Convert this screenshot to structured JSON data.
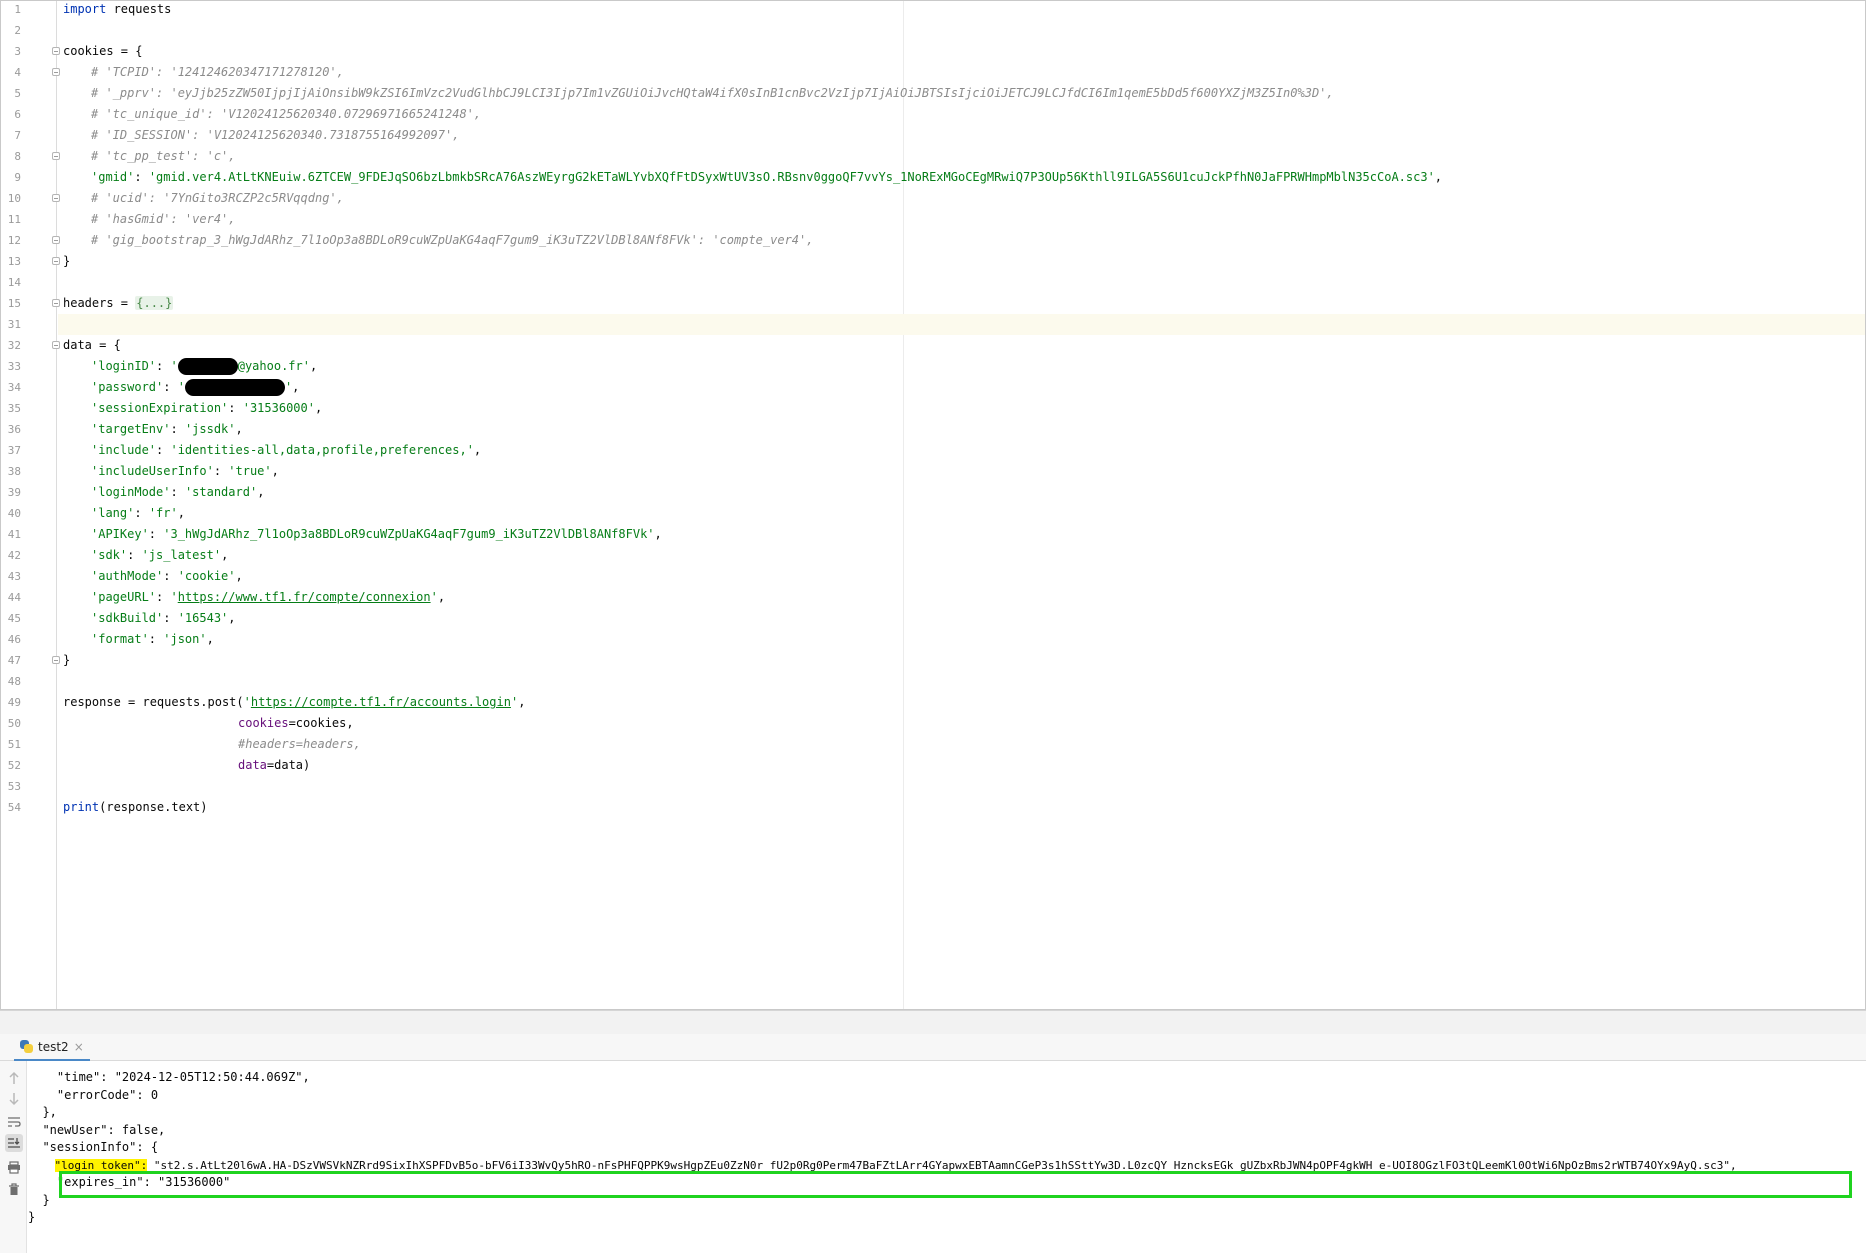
{
  "editor": {
    "lines": [
      {
        "num": "1",
        "segments": [
          {
            "t": "import",
            "c": "kw"
          },
          {
            "t": " requests",
            "c": "plain"
          }
        ]
      },
      {
        "num": "2",
        "segments": []
      },
      {
        "num": "3",
        "segments": [
          {
            "t": "cookies = {",
            "c": "plain"
          }
        ]
      },
      {
        "num": "4",
        "segments": [
          {
            "t": "# 'TCPID': '124124620347171278120',",
            "c": "com"
          }
        ]
      },
      {
        "num": "5",
        "segments": [
          {
            "t": "# '_pprv': 'eyJjb25zZW50IjpjIjAiOnsibW9kZSI6ImVzc2VudGlhbCJ9LCI3Ijp7Im1vZGUiOiJvcHQtaW4ifX0sInB1cnBvc2VzIjp7IjAiOiJBTSIsIjciOiJETCJ9LCJfdCI6Im1qemE5bDd5f600YXZjM3Z5In0%3D',",
            "c": "com"
          }
        ]
      },
      {
        "num": "6",
        "segments": [
          {
            "t": "# 'tc_unique_id': 'V12024125620340.07296971665241248',",
            "c": "com"
          }
        ]
      },
      {
        "num": "7",
        "segments": [
          {
            "t": "# 'ID_SESSION': 'V12024125620340.7318755164992097',",
            "c": "com"
          }
        ]
      },
      {
        "num": "8",
        "segments": [
          {
            "t": "# 'tc_pp_test': 'c',",
            "c": "com"
          }
        ]
      },
      {
        "num": "9",
        "segments": [
          {
            "t": "'gmid'",
            "c": "str"
          },
          {
            "t": ": ",
            "c": "plain"
          },
          {
            "t": "'gmid.ver4.AtLtKNEuiw.6ZTCEW_9FDEJqSO6bzLbmkbSRcA76AszWEyrgG2kETaWLYvbXQfFtDSyxWtUV3sO.RBsnv0ggoQF7vvYs_1NoRExMGoCEgMRwiQ7P3OUp56Kthll9ILGA5S6U1cuJckPfhN0JaFPRWHmpMblN35cCoA.sc3'",
            "c": "str"
          },
          {
            "t": ",",
            "c": "plain"
          }
        ]
      },
      {
        "num": "10",
        "segments": [
          {
            "t": "# 'ucid': '7YnGito3RCZP2c5RVqqdng',",
            "c": "com"
          }
        ]
      },
      {
        "num": "11",
        "segments": [
          {
            "t": "# 'hasGmid': 'ver4',",
            "c": "com"
          }
        ]
      },
      {
        "num": "12",
        "segments": [
          {
            "t": "# 'gig_bootstrap_3_hWgJdARhz_7l1oOp3a8BDLoR9cuWZpUaKG4aqF7gum9_iK3uTZ2VlDBl8ANf8FVk': 'compte_ver4',",
            "c": "com"
          }
        ]
      },
      {
        "num": "13",
        "segments": [
          {
            "t": "}",
            "c": "plain"
          }
        ]
      },
      {
        "num": "14",
        "segments": []
      },
      {
        "num": "15",
        "segments": [
          {
            "t": "headers = ",
            "c": "plain"
          },
          {
            "t": "{...}",
            "c": "folded"
          }
        ]
      },
      {
        "num": "31",
        "segments": []
      },
      {
        "num": "32",
        "segments": [
          {
            "t": "data = {",
            "c": "plain"
          }
        ]
      },
      {
        "num": "33",
        "segments": [
          {
            "t": "'loginID'",
            "c": "str"
          },
          {
            "t": ": ",
            "c": "plain"
          },
          {
            "t": "'",
            "c": "str"
          },
          {
            "t": "",
            "c": "redact-a"
          },
          {
            "t": "@yahoo.fr'",
            "c": "str"
          },
          {
            "t": ",",
            "c": "plain"
          }
        ]
      },
      {
        "num": "34",
        "segments": [
          {
            "t": "'password'",
            "c": "str"
          },
          {
            "t": ": ",
            "c": "plain"
          },
          {
            "t": "'",
            "c": "str"
          },
          {
            "t": "",
            "c": "redact-b"
          },
          {
            "t": "'",
            "c": "str"
          },
          {
            "t": ",",
            "c": "plain"
          }
        ]
      },
      {
        "num": "35",
        "segments": [
          {
            "t": "'sessionExpiration'",
            "c": "str"
          },
          {
            "t": ": ",
            "c": "plain"
          },
          {
            "t": "'31536000'",
            "c": "str"
          },
          {
            "t": ",",
            "c": "plain"
          }
        ]
      },
      {
        "num": "36",
        "segments": [
          {
            "t": "'targetEnv'",
            "c": "str"
          },
          {
            "t": ": ",
            "c": "plain"
          },
          {
            "t": "'jssdk'",
            "c": "str"
          },
          {
            "t": ",",
            "c": "plain"
          }
        ]
      },
      {
        "num": "37",
        "segments": [
          {
            "t": "'include'",
            "c": "str"
          },
          {
            "t": ": ",
            "c": "plain"
          },
          {
            "t": "'identities-all,data,profile,preferences,'",
            "c": "str"
          },
          {
            "t": ",",
            "c": "plain"
          }
        ]
      },
      {
        "num": "38",
        "segments": [
          {
            "t": "'includeUserInfo'",
            "c": "str"
          },
          {
            "t": ": ",
            "c": "plain"
          },
          {
            "t": "'true'",
            "c": "str"
          },
          {
            "t": ",",
            "c": "plain"
          }
        ]
      },
      {
        "num": "39",
        "segments": [
          {
            "t": "'loginMode'",
            "c": "str"
          },
          {
            "t": ": ",
            "c": "plain"
          },
          {
            "t": "'standard'",
            "c": "str"
          },
          {
            "t": ",",
            "c": "plain"
          }
        ]
      },
      {
        "num": "40",
        "segments": [
          {
            "t": "'lang'",
            "c": "str"
          },
          {
            "t": ": ",
            "c": "plain"
          },
          {
            "t": "'fr'",
            "c": "str"
          },
          {
            "t": ",",
            "c": "plain"
          }
        ]
      },
      {
        "num": "41",
        "segments": [
          {
            "t": "'APIKey'",
            "c": "str"
          },
          {
            "t": ": ",
            "c": "plain"
          },
          {
            "t": "'3_hWgJdARhz_7l1oOp3a8BDLoR9cuWZpUaKG4aqF7gum9_iK3uTZ2VlDBl8ANf8FVk'",
            "c": "str"
          },
          {
            "t": ",",
            "c": "plain"
          }
        ]
      },
      {
        "num": "42",
        "segments": [
          {
            "t": "'sdk'",
            "c": "str"
          },
          {
            "t": ": ",
            "c": "plain"
          },
          {
            "t": "'js_latest'",
            "c": "str"
          },
          {
            "t": ",",
            "c": "plain"
          }
        ]
      },
      {
        "num": "43",
        "segments": [
          {
            "t": "'authMode'",
            "c": "str"
          },
          {
            "t": ": ",
            "c": "plain"
          },
          {
            "t": "'cookie'",
            "c": "str"
          },
          {
            "t": ",",
            "c": "plain"
          }
        ]
      },
      {
        "num": "44",
        "segments": [
          {
            "t": "'pageURL'",
            "c": "str"
          },
          {
            "t": ": ",
            "c": "plain"
          },
          {
            "t": "'",
            "c": "str"
          },
          {
            "t": "https://www.tf1.fr/compte/connexion",
            "c": "url"
          },
          {
            "t": "'",
            "c": "str"
          },
          {
            "t": ",",
            "c": "plain"
          }
        ]
      },
      {
        "num": "45",
        "segments": [
          {
            "t": "'sdkBuild'",
            "c": "str"
          },
          {
            "t": ": ",
            "c": "plain"
          },
          {
            "t": "'16543'",
            "c": "str"
          },
          {
            "t": ",",
            "c": "plain"
          }
        ]
      },
      {
        "num": "46",
        "segments": [
          {
            "t": "'format'",
            "c": "str"
          },
          {
            "t": ": ",
            "c": "plain"
          },
          {
            "t": "'json'",
            "c": "str"
          },
          {
            "t": ",",
            "c": "plain"
          }
        ]
      },
      {
        "num": "47",
        "segments": [
          {
            "t": "}",
            "c": "plain"
          }
        ]
      },
      {
        "num": "48",
        "segments": []
      },
      {
        "num": "49",
        "segments": [
          {
            "t": "response = requests.post(",
            "c": "plain"
          },
          {
            "t": "'",
            "c": "str"
          },
          {
            "t": "https://compte.tf1.fr/accounts.login",
            "c": "url"
          },
          {
            "t": "'",
            "c": "str"
          },
          {
            "t": ",",
            "c": "plain"
          }
        ]
      },
      {
        "num": "50",
        "segments": [
          {
            "t": "cookies",
            "c": "param"
          },
          {
            "t": "=cookies,",
            "c": "plain"
          }
        ]
      },
      {
        "num": "51",
        "segments": [
          {
            "t": "#headers=headers,",
            "c": "com"
          }
        ]
      },
      {
        "num": "52",
        "segments": [
          {
            "t": "data",
            "c": "param"
          },
          {
            "t": "=data)",
            "c": "plain"
          }
        ]
      },
      {
        "num": "53",
        "segments": []
      },
      {
        "num": "54",
        "segments": [
          {
            "t": "print",
            "c": "kw"
          },
          {
            "t": "(response.text)",
            "c": "plain"
          }
        ]
      }
    ]
  },
  "run_panel": {
    "tab_label": "test2",
    "close_glyph": "×",
    "console_lines": [
      "    \"time\": \"2024-12-05T12:50:44.069Z\",",
      "    \"errorCode\": 0",
      "  },",
      "  \"newUser\": false,",
      "  \"sessionInfo\": {",
      "",
      "    \"expires_in\": \"31536000\"",
      "  }",
      "}"
    ],
    "login_token_key": "\"login_token\":",
    "login_token_value": " \"st2.s.AtLt20l6wA.HA-DSzVWSVkNZRrd9SixIhXSPFDvB5o-bFV6iI33WvQy5hRO-nFsPHFQPPK9wsHgpZEu0ZzN0r_fU2p0Rg0Perm47BaFZtLArr4GYapwxEBTAamnCGeP3s1hSSttYw3D.L0zcQY_HzncksEGk_gUZbxRbJWN4pOPF4gkWH_e-UOI8OGzlFO3tQLeemKl0OtWi6NpOzBms2rWTB74OYx9AyQ.sc3\","
  },
  "colors": {
    "keyword": "#0033b3",
    "string": "#067d17",
    "comment": "#8c8c8c",
    "highlight_box": "#1fd31f",
    "key_highlight": "#fff200"
  },
  "icons": [
    "python-file-icon",
    "arrow-up-icon",
    "arrow-down-icon",
    "soft-wrap-icon",
    "scroll-to-end-icon",
    "print-icon",
    "trash-icon"
  ]
}
